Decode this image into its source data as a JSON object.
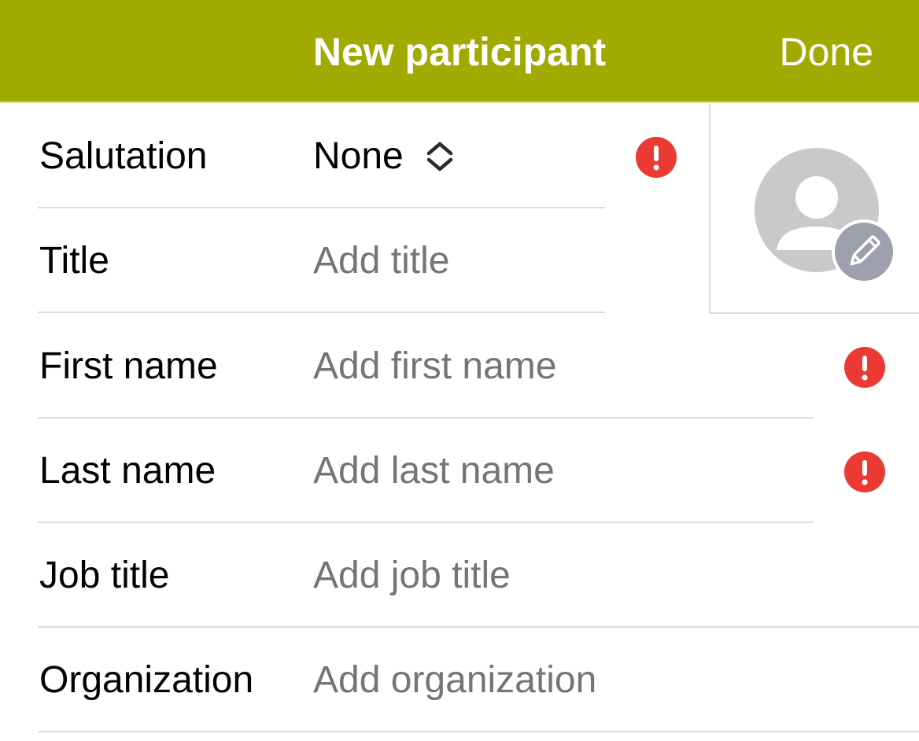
{
  "header": {
    "title": "New participant",
    "done_label": "Done",
    "background_color": "#a0aa00"
  },
  "form": {
    "salutation": {
      "label": "Salutation",
      "value": "None",
      "has_error": true
    },
    "title": {
      "label": "Title",
      "placeholder": "Add title"
    },
    "first_name": {
      "label": "First name",
      "placeholder": "Add first name",
      "has_error": true
    },
    "last_name": {
      "label": "Last name",
      "placeholder": "Add last name",
      "has_error": true
    },
    "job_title": {
      "label": "Job title",
      "placeholder": "Add job title"
    },
    "organization": {
      "label": "Organization",
      "placeholder": "Add organization"
    }
  },
  "avatar": {
    "icon": "person-icon",
    "edit_icon": "pencil-icon"
  },
  "colors": {
    "error": "#ea3a33",
    "placeholder": "#767676",
    "divider": "#dcdcdc"
  }
}
